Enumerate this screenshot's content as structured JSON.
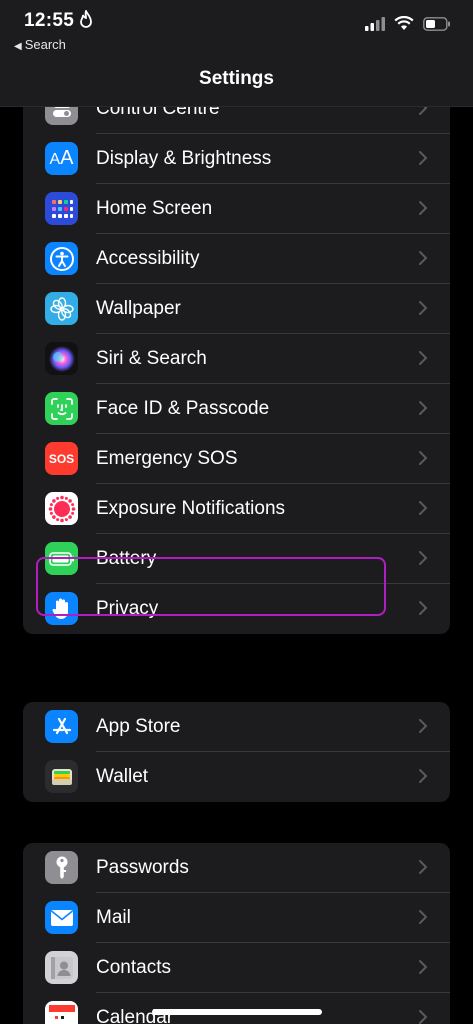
{
  "status_bar": {
    "time": "12:55",
    "back_label": "Search"
  },
  "header": {
    "title": "Settings"
  },
  "group1": [
    {
      "label": "Control Centre",
      "icon": "control-centre-icon",
      "color": "#8e8e93"
    },
    {
      "label": "Display & Brightness",
      "icon": "display-brightness-icon",
      "color": "#0a84ff"
    },
    {
      "label": "Home Screen",
      "icon": "home-screen-icon",
      "color": "#2c4bd8"
    },
    {
      "label": "Accessibility",
      "icon": "accessibility-icon",
      "color": "#0a84ff"
    },
    {
      "label": "Wallpaper",
      "icon": "wallpaper-icon",
      "color": "#32ade6"
    },
    {
      "label": "Siri & Search",
      "icon": "siri-icon",
      "color": "#1a1a2e"
    },
    {
      "label": "Face ID & Passcode",
      "icon": "face-id-icon",
      "color": "#30d158"
    },
    {
      "label": "Emergency SOS",
      "icon": "sos-icon",
      "color": "#ff3b30",
      "icon_text": "SOS"
    },
    {
      "label": "Exposure Notifications",
      "icon": "exposure-icon",
      "color": "#ffffff"
    },
    {
      "label": "Battery",
      "icon": "battery-icon",
      "color": "#30d158"
    },
    {
      "label": "Privacy",
      "icon": "privacy-hand-icon",
      "color": "#0a84ff"
    }
  ],
  "group2": [
    {
      "label": "App Store",
      "icon": "app-store-icon",
      "color": "#0a84ff"
    },
    {
      "label": "Wallet",
      "icon": "wallet-icon",
      "color": "#2c2c2e"
    }
  ],
  "group3": [
    {
      "label": "Passwords",
      "icon": "key-icon",
      "color": "#8e8e93"
    },
    {
      "label": "Mail",
      "icon": "mail-icon",
      "color": "#0a84ff"
    },
    {
      "label": "Contacts",
      "icon": "contacts-icon",
      "color": "#c7c7cc"
    },
    {
      "label": "Calendar",
      "icon": "calendar-icon",
      "color": "#ffffff"
    }
  ],
  "colors": {
    "highlight": "#b01dc0",
    "background": "#000000",
    "group_bg": "#1c1c1e"
  }
}
